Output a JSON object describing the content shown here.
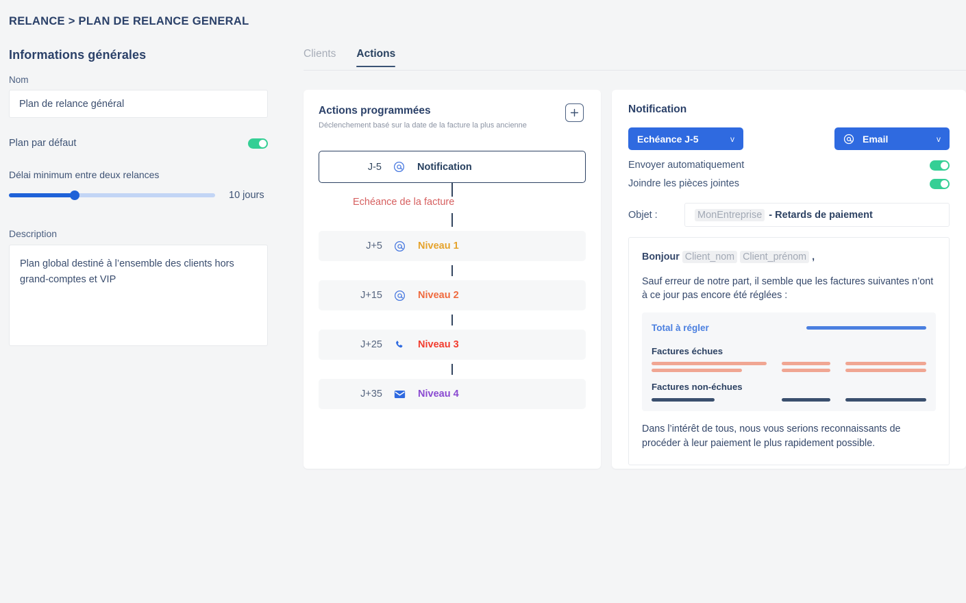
{
  "breadcrumb": "RELANCE > PLAN DE RELANCE GENERAL",
  "colors": {
    "accent_blue": "#2f6ae0",
    "slider_blue": "#1f62d8",
    "toggle_green": "#35cf95",
    "navy": "#2b4169",
    "due_red": "#d65f5f"
  },
  "general": {
    "section_title": "Informations générales",
    "name_label": "Nom",
    "name_value": "Plan de relance général",
    "default_plan_label": "Plan par défaut",
    "default_plan_on": true,
    "delay_label": "Délai minimum entre deux relances",
    "delay_value": "10 jours",
    "delay_percent": 32,
    "description_label": "Description",
    "description_value": "Plan global destiné à l’ensemble des clients hors grand-comptes et VIP"
  },
  "tabs": [
    {
      "label": "Clients",
      "active": false
    },
    {
      "label": "Actions",
      "active": true
    }
  ],
  "actions_panel": {
    "title": "Actions programmées",
    "subtitle": "Déclenchement basé sur la date de la facture la plus ancienne",
    "add_button_label": "+",
    "due_marker": "Echéance de la facture",
    "items": [
      {
        "day": "J-5",
        "icon": "at-icon",
        "icon_glyph": "@",
        "label": "Notification",
        "color": "#27405f",
        "icon_color": "#4a7ae0",
        "selected": true
      },
      {
        "day": "J+5",
        "icon": "at-icon",
        "icon_glyph": "@",
        "label": "Niveau 1",
        "color": "#e5a32c",
        "icon_color": "#4a7ae0",
        "selected": false
      },
      {
        "day": "J+15",
        "icon": "at-icon",
        "icon_glyph": "@",
        "label": "Niveau 2",
        "color": "#ef6a3e",
        "icon_color": "#4a7ae0",
        "selected": false
      },
      {
        "day": "J+25",
        "icon": "phone-icon",
        "icon_glyph": "",
        "label": "Niveau 3",
        "color": "#f23c2e",
        "icon_color": "#2f6ae0",
        "selected": false
      },
      {
        "day": "J+35",
        "icon": "envelope-icon",
        "icon_glyph": "",
        "label": "Niveau 4",
        "color": "#8a4ad1",
        "icon_color": "#2f6ae0",
        "selected": false
      }
    ]
  },
  "notification_panel": {
    "title": "Notification",
    "trigger_select": {
      "value": "Echéance J-5",
      "chevron": "v"
    },
    "channel_select": {
      "value": "Email",
      "icon": "at-icon",
      "chevron": "v"
    },
    "auto_send_label": "Envoyer automatiquement",
    "auto_send_on": true,
    "attach_label": "Joindre les pièces jointes",
    "attach_on": true,
    "subject_label": "Objet :",
    "subject_variable": "MonEntreprise",
    "subject_text": "- Retards de paiement",
    "email": {
      "greeting_word": "Bonjour",
      "var_lastname": "Client_nom",
      "var_firstname": "Client_prénom",
      "greeting_comma": ",",
      "paragraph_1": "Sauf erreur de notre part, il semble que les factures suivantes n’ont à ce jour pas encore été réglées :",
      "invoice_block": {
        "total_label": "Total à régler",
        "overdue_label": "Factures échues",
        "not_due_label": "Factures non-échues"
      },
      "paragraph_2": "Dans l’intérêt de tous, nous vous serions reconnaissants de procéder à leur paiement le plus rapidement possible."
    }
  }
}
